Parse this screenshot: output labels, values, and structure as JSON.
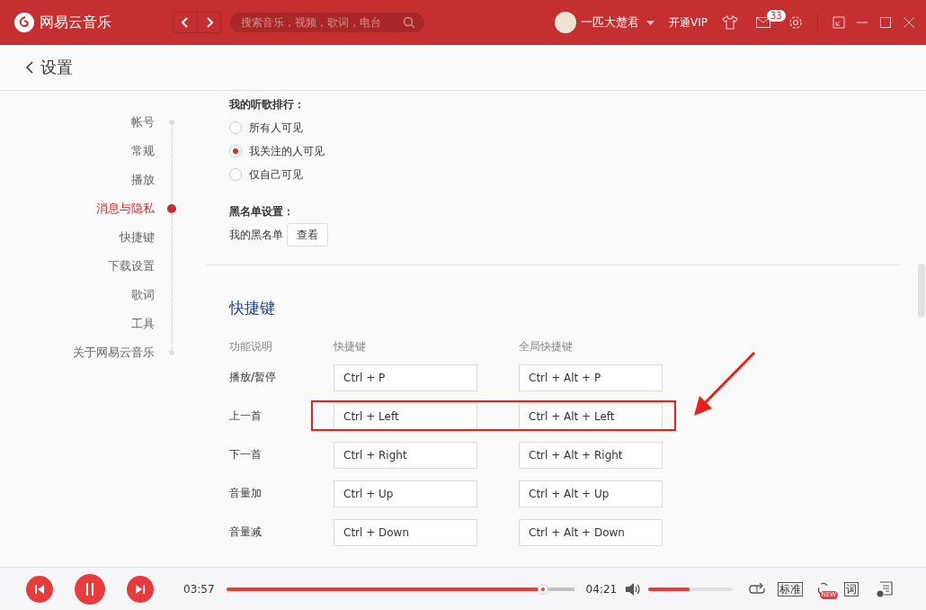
{
  "titlebar": {
    "app_name": "网易云音乐",
    "search": {
      "placeholder": "搜索音乐，视频，歌词，电台"
    },
    "username": "一匹大楚君",
    "vip_label": "开通VIP",
    "message_badge": "33"
  },
  "page": {
    "title": "设置"
  },
  "sidebar": {
    "items": [
      {
        "label": "帐号",
        "selected": false
      },
      {
        "label": "常规",
        "selected": false
      },
      {
        "label": "播放",
        "selected": false
      },
      {
        "label": "消息与隐私",
        "selected": true
      },
      {
        "label": "快捷键",
        "selected": false
      },
      {
        "label": "下载设置",
        "selected": false
      },
      {
        "label": "歌词",
        "selected": false
      },
      {
        "label": "工具",
        "selected": false
      },
      {
        "label": "关于网易云音乐",
        "selected": false
      }
    ]
  },
  "privacy": {
    "ranking_title": "我的听歌排行：",
    "options": [
      {
        "label": "所有人可见",
        "selected": false
      },
      {
        "label": "我关注的人可见",
        "selected": true
      },
      {
        "label": "仅自己可见",
        "selected": false
      }
    ],
    "blacklist_title": "黑名单设置：",
    "blacklist_label": "我的黑名单",
    "view_button": "查看"
  },
  "shortcuts": {
    "title": "快捷键",
    "columns": [
      "功能说明",
      "快捷键",
      "全局快捷键"
    ],
    "rows": [
      {
        "action": "播放/暂停",
        "shortcut": "Ctrl + P",
        "global_shortcut": "Ctrl + Alt + P"
      },
      {
        "action": "上一首",
        "shortcut": "Ctrl + Left",
        "global_shortcut": "Ctrl + Alt + Left"
      },
      {
        "action": "下一首",
        "shortcut": "Ctrl + Right",
        "global_shortcut": "Ctrl + Alt + Right"
      },
      {
        "action": "音量加",
        "shortcut": "Ctrl + Up",
        "global_shortcut": "Ctrl + Alt + Up"
      },
      {
        "action": "音量减",
        "shortcut": "Ctrl + Down",
        "global_shortcut": "Ctrl + Alt + Down"
      }
    ]
  },
  "player": {
    "elapsed": "03:57",
    "total": "04:21",
    "progress": {
      "level": 0.91
    },
    "volume": {
      "level": 0.49
    },
    "quality_label": "标准",
    "new_badge": "NEW",
    "lyrics_label": "词"
  }
}
